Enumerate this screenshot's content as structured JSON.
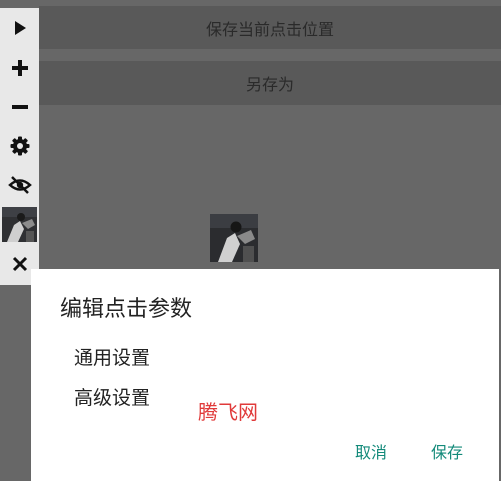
{
  "background": {
    "save_position_label": "保存当前点击位置",
    "save_as_label": "另存为"
  },
  "toolbar": {
    "items": [
      "play-icon",
      "plus-icon",
      "minus-icon",
      "gear-icon",
      "eye-off-icon",
      "thumbnail",
      "close-icon"
    ]
  },
  "dialog": {
    "title": "编辑点击参数",
    "general_settings": "通用设置",
    "advanced_settings": "高级设置",
    "watermark": "腾飞网",
    "cancel_label": "取消",
    "save_label": "保存"
  },
  "colors": {
    "overlay": "#676767",
    "bar": "#595959",
    "toolbar": "#e8e8e8",
    "accent": "#138a7a",
    "watermark": "#e03a3a"
  }
}
